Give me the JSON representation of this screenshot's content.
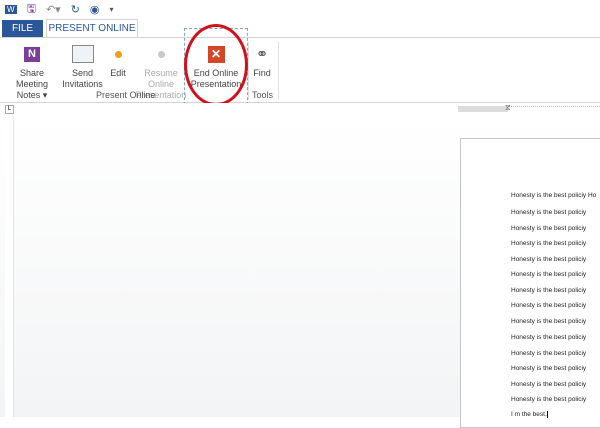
{
  "qat": {
    "icons": [
      "word-icon",
      "save-icon",
      "undo-icon",
      "redo-icon",
      "touch-mode-icon",
      "customize-icon"
    ]
  },
  "tabs": {
    "file": "FILE",
    "present_online": "PRESENT ONLINE"
  },
  "ribbon": {
    "buttons": [
      {
        "label1": "Share Meeting",
        "label2": "Notes ▾",
        "icon": "onenote-icon",
        "enabled": true
      },
      {
        "label1": "Send",
        "label2": "Invitations",
        "icon": "invitation-icon",
        "enabled": true
      },
      {
        "label1": "Edit",
        "label2": "",
        "icon": "edit-dot-icon",
        "enabled": true
      },
      {
        "label1": "Resume Online",
        "label2": "Presentation",
        "icon": "resume-dot-icon",
        "enabled": false
      },
      {
        "label1": "End Online",
        "label2": "Presentation",
        "icon": "end-x-icon",
        "enabled": true
      },
      {
        "label1": "Find",
        "label2": "",
        "icon": "binoculars-icon",
        "enabled": true
      }
    ],
    "groups": {
      "present_online": "Present Online",
      "tools": "Tools"
    }
  },
  "colors": {
    "accent": "#2b579a",
    "annotation": "#d0101a",
    "end_button": "#d24726"
  },
  "document": {
    "lines": [
      "Honesty is the best policiy Ho",
      "Honesty is the best policiy",
      "Honesty is the best policiy",
      "Honesty is the best policiy",
      "Honesty is the best policiy",
      "Honesty is the best policiy",
      "Honesty is the best policiy",
      "Honesty is the best policiy",
      "Honesty is the best policiy",
      "Honesty is the best policiy",
      "Honesty is the best policiy",
      "Honesty is the best policiy",
      "Honesty is the best policiy",
      "Honesty is the best policiy",
      "I m the best."
    ]
  }
}
